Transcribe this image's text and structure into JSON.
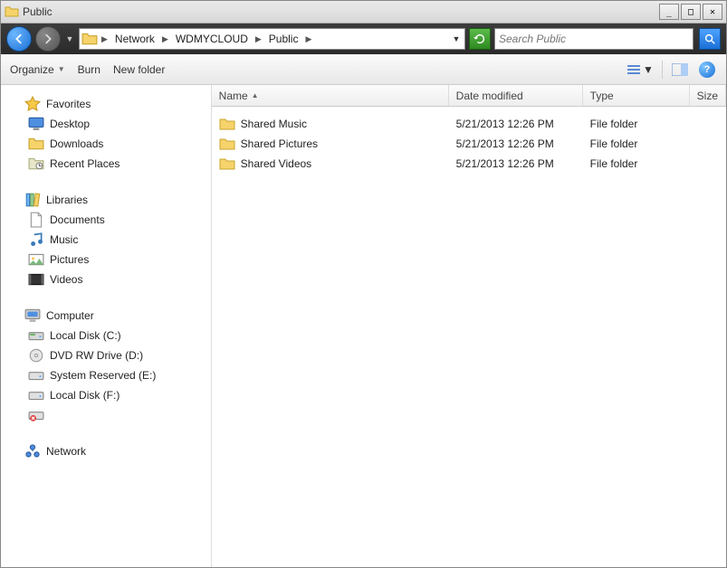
{
  "window": {
    "title": "Public"
  },
  "breadcrumb": {
    "segments": [
      "Network",
      "WDMYCLOUD",
      "Public"
    ]
  },
  "search": {
    "placeholder": "Search Public"
  },
  "toolbar": {
    "organize": "Organize",
    "burn": "Burn",
    "newfolder": "New folder"
  },
  "columns": {
    "name": "Name",
    "date": "Date modified",
    "type": "Type",
    "size": "Size"
  },
  "nav": {
    "favorites": {
      "label": "Favorites",
      "items": [
        {
          "label": "Desktop",
          "icon": "desktop"
        },
        {
          "label": "Downloads",
          "icon": "folder"
        },
        {
          "label": "Recent Places",
          "icon": "recent"
        }
      ]
    },
    "libraries": {
      "label": "Libraries",
      "items": [
        {
          "label": "Documents",
          "icon": "document"
        },
        {
          "label": "Music",
          "icon": "music"
        },
        {
          "label": "Pictures",
          "icon": "pictures"
        },
        {
          "label": "Videos",
          "icon": "videos"
        }
      ]
    },
    "computer": {
      "label": "Computer",
      "items": [
        {
          "label": "Local Disk (C:)",
          "icon": "disk"
        },
        {
          "label": "DVD RW Drive (D:)",
          "icon": "dvd"
        },
        {
          "label": "System Reserved (E:)",
          "icon": "drive"
        },
        {
          "label": "Local Disk (F:)",
          "icon": "drive"
        },
        {
          "label": "",
          "icon": "drive-err"
        }
      ]
    },
    "network": {
      "label": "Network"
    }
  },
  "rows": [
    {
      "name": "Shared Music",
      "date": "5/21/2013 12:26 PM",
      "type": "File folder"
    },
    {
      "name": "Shared Pictures",
      "date": "5/21/2013 12:26 PM",
      "type": "File folder"
    },
    {
      "name": "Shared Videos",
      "date": "5/21/2013 12:26 PM",
      "type": "File folder"
    }
  ]
}
